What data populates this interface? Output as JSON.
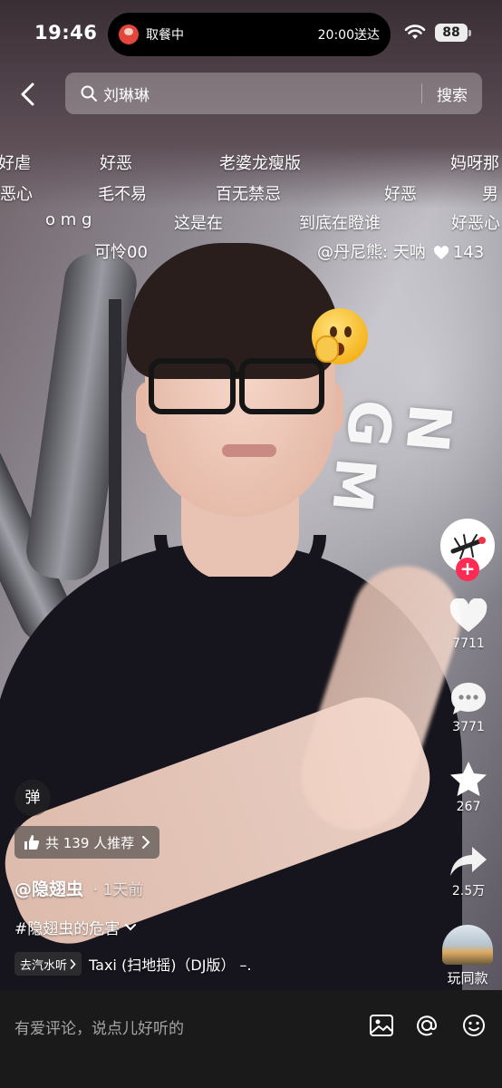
{
  "status_bar": {
    "time": "19:46",
    "island_left": "取餐中",
    "island_right": "20:00送达",
    "battery": "88"
  },
  "search": {
    "query": "刘琳琳",
    "button": "搜索"
  },
  "danmaku": [
    "好虐",
    "好恶",
    "老婆龙瘦版",
    "妈呀那",
    "恶心",
    "毛不易",
    "百无禁忌",
    "好恶",
    "男",
    "o m g",
    "这是在",
    "到底在瞪谁",
    "好恶心",
    "可怜00",
    "@丹尼熊: 天呐",
    "143"
  ],
  "rail": {
    "likes": "7711",
    "comments": "3771",
    "favorites": "267",
    "shares": "2.5万",
    "play_same": "玩同款"
  },
  "info": {
    "danmu_toggle": "弹",
    "recommend": "共 139 人推荐",
    "author": "@隐翅虫",
    "time": "· 1天前",
    "hashtag": "#隐翅虫的危害",
    "music_tag": "去汽水听",
    "music_title": "Taxi (扫地摇)（DJ版） –."
  },
  "comment_bar": {
    "placeholder": "有爱评论，说点儿好听的"
  },
  "colors": {
    "follow_plus": "#fe2c55",
    "comment_bar_bg": "#1a1a1a"
  },
  "icons": [
    "back-icon",
    "search-icon",
    "wifi-icon",
    "heart-icon",
    "comment-icon",
    "star-icon",
    "share-icon",
    "thumbs-up-icon",
    "chevron-right-icon",
    "chevron-down-icon",
    "image-icon",
    "at-icon",
    "emoji-icon"
  ]
}
